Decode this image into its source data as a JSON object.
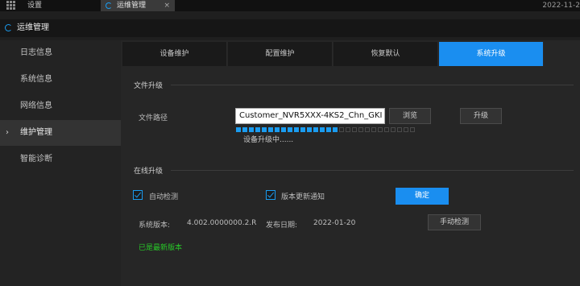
{
  "topbar": {
    "tabs": [
      {
        "label": "设置"
      },
      {
        "label": "运维管理"
      }
    ],
    "close_symbol": "×",
    "date": "2022-11-2"
  },
  "title": "运维管理",
  "sidebar": {
    "items": [
      {
        "label": "日志信息"
      },
      {
        "label": "系统信息"
      },
      {
        "label": "网络信息"
      },
      {
        "label": "维护管理",
        "active": true
      },
      {
        "label": "智能诊断"
      }
    ],
    "chevron": "›"
  },
  "subtabs": [
    {
      "label": "设备维护"
    },
    {
      "label": "配置维护"
    },
    {
      "label": "恢复默认"
    },
    {
      "label": "系统升级",
      "active": true
    }
  ],
  "file_upgrade": {
    "section_title": "文件升级",
    "path_label": "文件路径",
    "path_value": "Customer_NVR5XXX-4KS2_Chn_GKI",
    "browse_label": "浏览",
    "upgrade_label": "升级",
    "progress": {
      "filled": 16,
      "total": 28,
      "fraction": 0.57
    },
    "status_text": "设备升级中......"
  },
  "online_upgrade": {
    "section_title": "在线升级",
    "auto_check_label": "自动检测",
    "auto_check_checked": true,
    "notify_label": "版本更新通知",
    "notify_checked": true,
    "confirm_label": "确定",
    "version_label": "系统版本:",
    "version_value": "4.002.0000000.2.R",
    "release_label": "发布日期:",
    "release_value": "2022-01-20",
    "manual_check_label": "手动检测",
    "latest_text": "已是最新版本"
  },
  "colors": {
    "accent": "#1a8ef0",
    "success": "#28c928"
  }
}
